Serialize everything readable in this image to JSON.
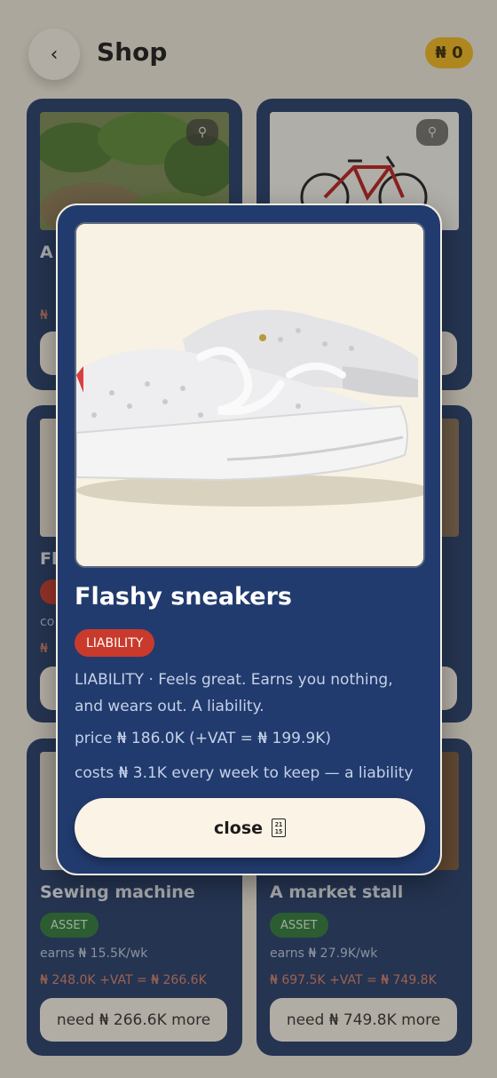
{
  "header": {
    "back_label": "‹",
    "title": "Shop",
    "balance": "₦ 0"
  },
  "cards": [
    {
      "name": "A",
      "earn": "",
      "price": "₦",
      "need": ""
    },
    {
      "name": "",
      "earn": "",
      "price": "",
      "need": ""
    },
    {
      "name": "Fl",
      "earn": "co",
      "price": "₦",
      "need": ""
    },
    {
      "name": "",
      "earn": "",
      "price": "",
      "need": ""
    },
    {
      "name": "Sewing machine",
      "badge": "ASSET",
      "earn": "earns ₦ 15.5K/wk",
      "price": "₦ 248.0K  +VAT = ₦ 266.6K",
      "need": "need ₦ 266.6K more"
    },
    {
      "name": "A market stall",
      "badge": "ASSET",
      "earn": "earns ₦ 27.9K/wk",
      "price": "₦ 697.5K  +VAT = ₦ 749.8K",
      "need": "need ₦ 749.8K more"
    }
  ],
  "modal": {
    "title": "Flashy sneakers",
    "badge": "LIABILITY",
    "description": "LIABILITY · Feels great. Earns you nothing, and wears out. A liability.",
    "price": "price ₦ 186.0K   (+VAT = ₦ 199.9K)",
    "costs": "costs ₦ 3.1K every week to keep — a liability",
    "close_label": "close",
    "close_icon_top": "21",
    "close_icon_bottom": "15"
  },
  "colors": {
    "card_bg": "#253c6a",
    "modal_bg": "#223b6e",
    "liability": "#c93a2c",
    "asset": "#2f7a3d",
    "coin": "#f0b820"
  },
  "icons": [
    "back-chevron-icon",
    "zoom-icon",
    "keyboard-shortcut-icon"
  ]
}
